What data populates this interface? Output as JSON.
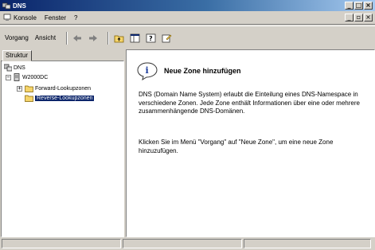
{
  "window": {
    "title": "DNS"
  },
  "menu": {
    "konsole": "Konsole",
    "fenster": "Fenster",
    "help": "?"
  },
  "toolbar": {
    "vorgang": "Vorgang",
    "ansicht": "Ansicht"
  },
  "left": {
    "tab": "Struktur",
    "tree": {
      "root": "DNS",
      "server": "W2000DC",
      "forward": "Forward-Lookupzonen",
      "reverse": "Reverse-Lookupzonen"
    }
  },
  "right": {
    "title": "Neue Zone hinzufügen",
    "para1": "DNS (Domain Name System) erlaubt die Einteilung eines DNS-Namespace in verschiedene Zonen. Jede Zone enthält Informationen über eine oder mehrere zusammenhängende DNS-Domänen.",
    "para2": "Klicken Sie im Menü \"Vorgang\" auf \"Neue Zone\", um eine neue Zone hinzuzufügen."
  },
  "colors": {
    "selection": "#0a246a",
    "titlebar": "#0a246a",
    "folder": "#f5d46a"
  },
  "icons": [
    "dns-app-icon",
    "console-icon",
    "back-icon",
    "forward-icon",
    "up-folder-icon",
    "show-pane-icon",
    "help-icon",
    "properties-icon",
    "info-icon",
    "folder-icon",
    "server-icon"
  ]
}
